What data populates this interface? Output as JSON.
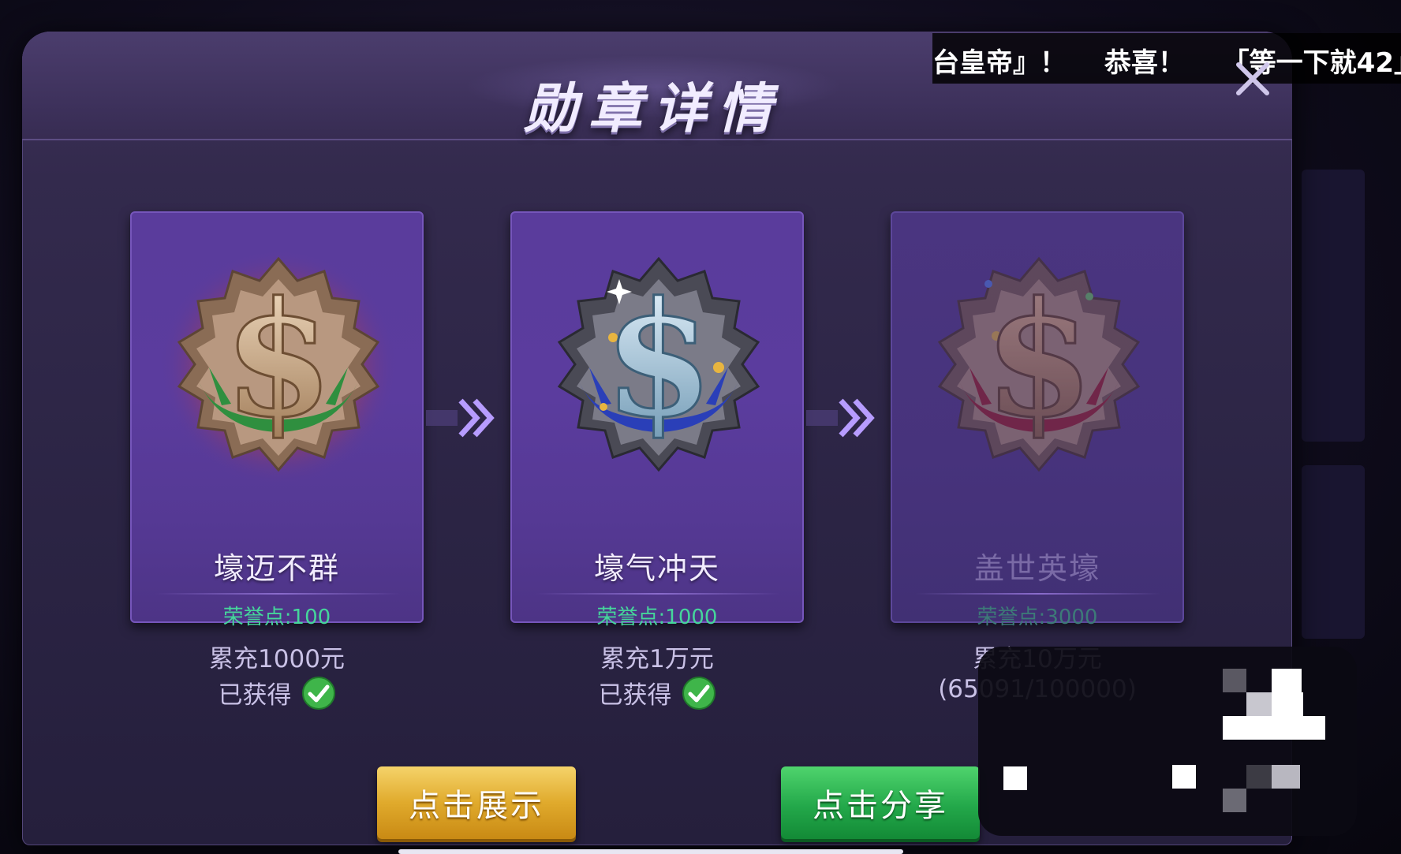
{
  "dialog": {
    "title": "勋章详情"
  },
  "ticker": {
    "text": "台皇帝』！ 恭喜！ 「等一下就42」"
  },
  "medals": [
    {
      "name": "壕迈不群",
      "points_label": "荣誉点:100",
      "requirement": "累充1000元",
      "status": "已获得",
      "obtained": true,
      "ribbon_color": "#2f8f3f",
      "coin_color": "#d8b28a"
    },
    {
      "name": "壕气冲天",
      "points_label": "荣誉点:1000",
      "requirement": "累充1万元",
      "status": "已获得",
      "obtained": true,
      "ribbon_color": "#2a3fb8",
      "coin_color": "#b8d8ea"
    },
    {
      "name": "盖世英壕",
      "points_label": "荣誉点:3000",
      "requirement": "累充10万元",
      "status": "(65091/100000)",
      "obtained": false,
      "progress": 0.65091,
      "ribbon_color": "#8a1f2a",
      "coin_color": "#a87c55"
    }
  ],
  "buttons": {
    "show_label": "点击展示",
    "share_label": "点击分享"
  },
  "colors": {
    "accent_gold": "#e0aa2c",
    "accent_green": "#23a84a",
    "points_green": "#45d69b",
    "panel_purple": "#5a3c9c"
  }
}
